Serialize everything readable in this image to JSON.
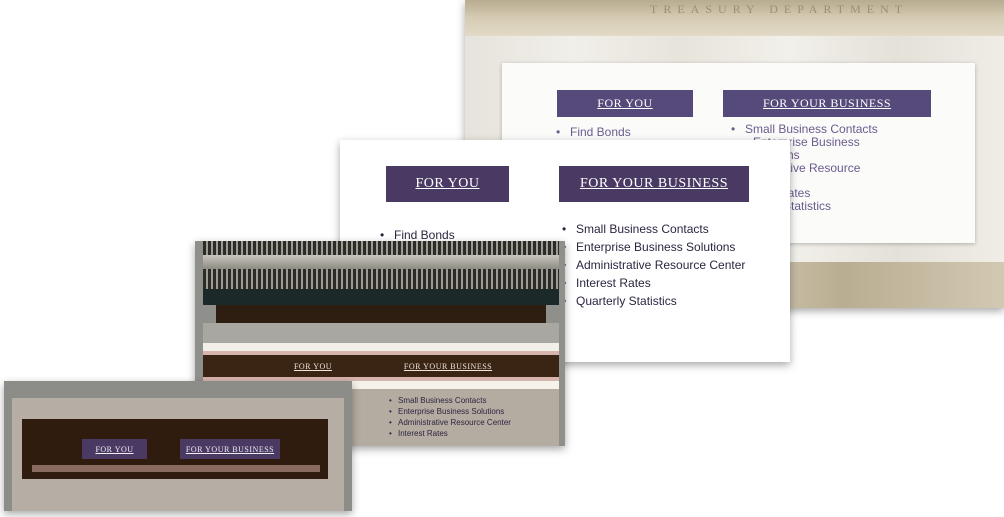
{
  "screenshot1": {
    "frieze_text": "TREASURY   DEPARTMENT",
    "tab_you": "FOR YOU",
    "tab_business": "FOR YOUR BUSINESS",
    "you_items": [
      "Find Bonds"
    ],
    "business_items": [
      "Small Business Contacts",
      "Enterprise Business",
      "ns",
      "strative Resource",
      "Rates",
      "rly Statistics"
    ]
  },
  "screenshot2": {
    "tab_you": "FOR YOU",
    "tab_business": "FOR YOUR BUSINESS",
    "you_items": [
      "Find Bonds"
    ],
    "business_items": [
      "Small Business Contacts",
      "Enterprise Business Solutions",
      "Administrative Resource Center",
      "Interest Rates",
      "Quarterly Statistics"
    ]
  },
  "screenshot3": {
    "tab_you": "FOR YOU",
    "tab_business": "FOR YOUR BUSINESS",
    "business_items": [
      "Small Business Contacts",
      "Enterprise Business Solutions",
      "Administrative Resource Center",
      "Interest Rates"
    ]
  },
  "screenshot4": {
    "tab_you": "FOR YOU",
    "tab_business": "FOR YOUR BUSINESS"
  },
  "colors": {
    "tab_purple": "#4c3f69",
    "tab_purple_dark": "#3f2c4f",
    "list_purple": "#6b5b8f",
    "list_dark": "#2d2540",
    "brown_dark": "#2f1c0e"
  }
}
